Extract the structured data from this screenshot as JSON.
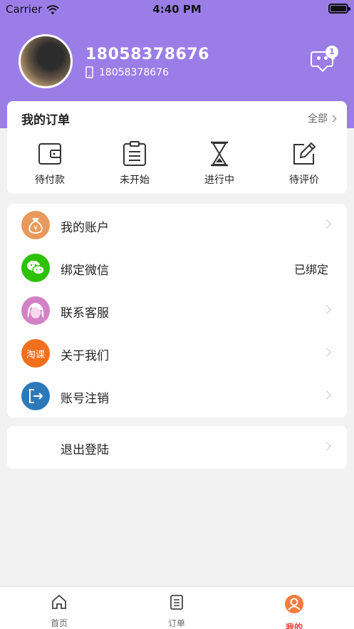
{
  "status_bar": {
    "carrier": "Carrier",
    "time": "4:40 PM"
  },
  "profile": {
    "name": "18058378676",
    "phone": "18058378676",
    "message_count": "1"
  },
  "orders": {
    "title": "我的订单",
    "all_label": "全部",
    "items": [
      {
        "label": "待付款",
        "icon": "wallet-icon"
      },
      {
        "label": "未开始",
        "icon": "clipboard-icon"
      },
      {
        "label": "进行中",
        "icon": "hourglass-icon"
      },
      {
        "label": "待评价",
        "icon": "edit-icon"
      }
    ]
  },
  "menu": {
    "items": [
      {
        "label": "我的账户",
        "icon": "money-bag-icon",
        "color": "#e89a5c"
      },
      {
        "label": "绑定微信",
        "icon": "wechat-icon",
        "color": "#2dc100",
        "status": "已绑定"
      },
      {
        "label": "联系客服",
        "icon": "support-agent-icon",
        "color": "#d282c4"
      },
      {
        "label": "关于我们",
        "icon": "taoke-logo-icon",
        "color": "#f26f1e",
        "icon_text": "淘课"
      },
      {
        "label": "账号注销",
        "icon": "exit-icon",
        "color": "#2d78b8"
      }
    ],
    "logout_label": "退出登陆"
  },
  "tabbar": {
    "items": [
      {
        "label": "首页",
        "icon": "home-icon"
      },
      {
        "label": "订单",
        "icon": "order-list-icon"
      },
      {
        "label": "我的",
        "icon": "user-icon",
        "active": true
      }
    ],
    "active_color": "#e63b2e"
  },
  "colors": {
    "header": "#9b7de8"
  }
}
